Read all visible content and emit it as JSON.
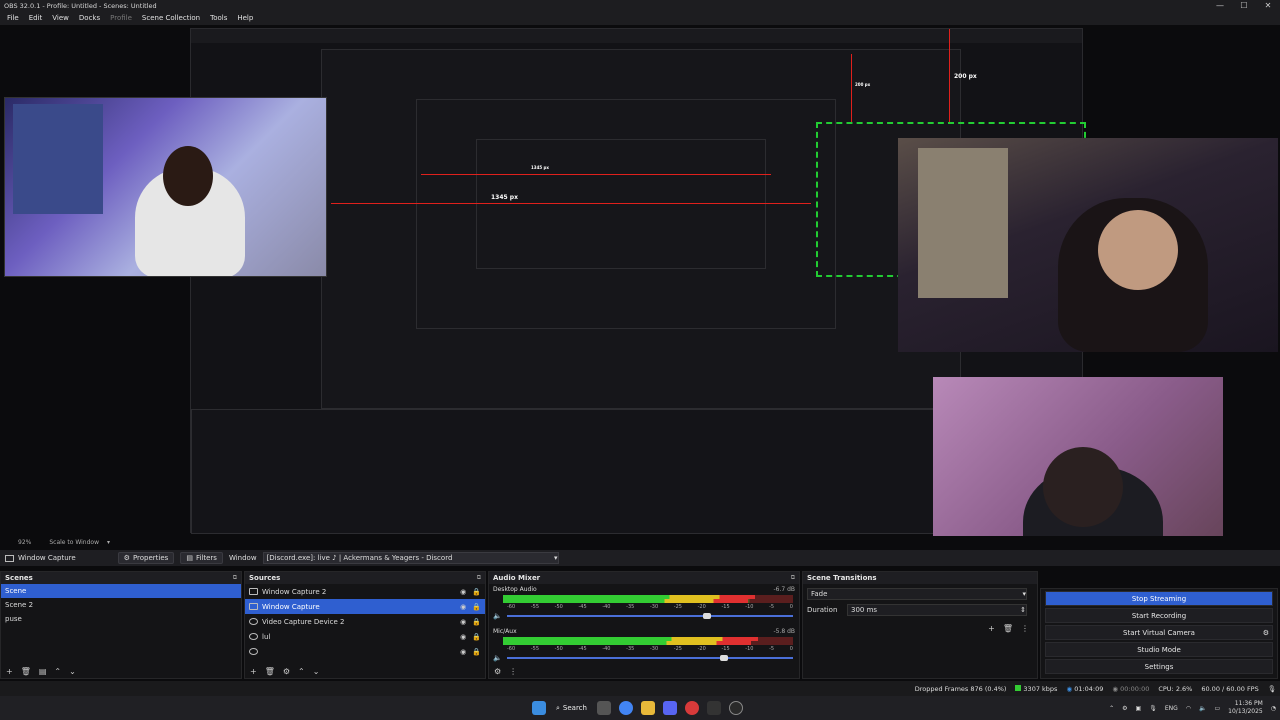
{
  "window": {
    "title": "OBS 32.0.1 - Profile: Untitled - Scenes: Untitled",
    "minimize": "—",
    "maximize": "☐",
    "close": "✕"
  },
  "menu": {
    "items": [
      "File",
      "Edit",
      "View",
      "Docks",
      "Profile",
      "Scene Collection",
      "Tools",
      "Help"
    ]
  },
  "preview": {
    "recursion_labels": {
      "px_200_top": "200 px",
      "px_200_small": "200 px",
      "px_1345": "1345 px",
      "px_1345_small": "1345 px"
    }
  },
  "zoom": {
    "value": "92%",
    "scale_label": "Scale to Window"
  },
  "toolbar": {
    "source_name": "Window Capture",
    "properties_label": "Properties",
    "filters_label": "Filters",
    "window_label": "Window",
    "window_value": "[Discord.exe]: live ♪ | Ackermans & Yeagers - Discord"
  },
  "scenes": {
    "title": "Scenes",
    "items": [
      {
        "label": "Scene",
        "selected": true
      },
      {
        "label": "Scene 2",
        "selected": false
      },
      {
        "label": "puse",
        "selected": false
      }
    ],
    "footer_icons": [
      "add-icon",
      "remove-icon",
      "filter-icon",
      "up-icon",
      "down-icon"
    ]
  },
  "sources": {
    "title": "Sources",
    "items": [
      {
        "label": "Window Capture 2",
        "selected": false
      },
      {
        "label": "Window Capture",
        "selected": true
      },
      {
        "label": "Video Capture Device 2",
        "selected": false
      },
      {
        "label": "lul",
        "selected": false
      },
      {
        "label": "",
        "selected": false
      }
    ],
    "footer_icons": [
      "add-icon",
      "remove-icon",
      "gear-icon",
      "up-icon",
      "down-icon"
    ]
  },
  "mixer": {
    "title": "Audio Mixer",
    "channels": [
      {
        "name": "Desktop Audio",
        "db": "-6.7 dB",
        "level": 0.87,
        "volume": 0.7
      },
      {
        "name": "Mic/Aux",
        "db": "-5.8 dB",
        "level": 0.88,
        "volume": 0.76
      }
    ],
    "scale": [
      "-60",
      "-55",
      "-50",
      "-45",
      "-40",
      "-35",
      "-30",
      "-25",
      "-20",
      "-15",
      "-10",
      "-5",
      "0"
    ]
  },
  "transitions": {
    "title": "Scene Transitions",
    "selected": "Fade",
    "duration_label": "Duration",
    "duration_value": "300 ms"
  },
  "controls": {
    "stop_streaming": "Stop Streaming",
    "start_recording": "Start Recording",
    "start_virtual_camera": "Start Virtual Camera",
    "studio_mode": "Studio Mode",
    "settings": "Settings"
  },
  "status": {
    "dropped_frames": "Dropped Frames 876 (0.4%)",
    "bitrate": "3307 kbps",
    "stream_time": "01:04:09",
    "record_time": "00:00:00",
    "cpu": "CPU: 2.6%",
    "fps": "60.00 / 60.00 FPS"
  },
  "taskbar": {
    "search_label": "Search",
    "lang": "ENG",
    "time": "11:36 PM",
    "date": "10/13/2025"
  },
  "colors": {
    "accent": "#2f5fd0",
    "meter_green": "#33cc33",
    "meter_yellow": "#e0c020",
    "meter_red": "#e03030",
    "guide_red": "#e0201c",
    "guide_green": "#22cc33"
  }
}
